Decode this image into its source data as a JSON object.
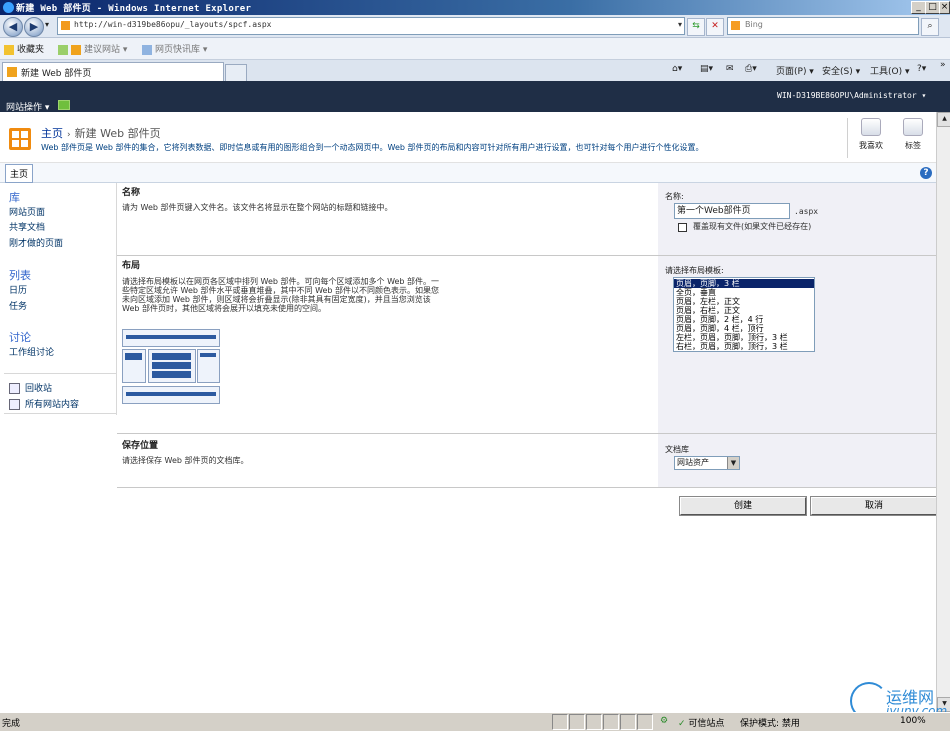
{
  "window": {
    "title": "新建 Web 部件页 - Windows Internet Explorer"
  },
  "address": {
    "url": "http://win-d319be86opu/_layouts/spcf.aspx",
    "search_placeholder": "Bing"
  },
  "favorites": {
    "label": "收藏夹",
    "items": [
      "建议网站 ▾",
      "网页快讯库 ▾"
    ]
  },
  "tab": {
    "title": "新建 Web 部件页"
  },
  "toolbar": {
    "page": "页面(P) ▾",
    "safety": "安全(S) ▾",
    "tools": "工具(O) ▾",
    "help": "?▾",
    "more": "»"
  },
  "sp": {
    "site_actions": "网站操作 ▾",
    "user": "WIN-D319BE86OPU\\Administrator ▾"
  },
  "titlearea": {
    "crumb_home": "主页",
    "crumb_sep": "›",
    "crumb_current": "新建 Web 部件页",
    "description": "Web 部件页是 Web 部件的集合，它将列表数据、即时信息或有用的图形组合到一个动态网页中。Web 部件页的布局和内容可针对所有用户进行设置，也可针对每个用户进行个性化设置。",
    "like": "我喜欢",
    "tags": "标签"
  },
  "topnav": {
    "home": "主页",
    "help": "?"
  },
  "leftnav": {
    "h_library": "库",
    "site_pages": "网站页面",
    "shared_docs": "共享文档",
    "recent_page": "刚才做的页面",
    "h_lists": "列表",
    "calendar": "日历",
    "tasks": "任务",
    "h_discussion": "讨论",
    "team_discussion": "工作组讨论",
    "recycle": "回收站",
    "all_content": "所有网站内容"
  },
  "form": {
    "name_heading": "名称",
    "name_desc": "请为 Web 部件页键入文件名。该文件名将显示在整个网站的标题和链接中。",
    "name_label": "名称:",
    "name_value": "第一个Web部件页",
    "ext": ".aspx",
    "overwrite": "覆盖现有文件(如果文件已经存在)",
    "layout_heading": "布局",
    "layout_desc": [
      "请选择布局模板以在网页各区域中排列 Web 部件。可向每个区域添加多个 Web 部件。一",
      "些特定区域允许 Web 部件水平或垂直堆叠，其中不同 Web 部件以不同颜色表示。如果您",
      "未向区域添加 Web 部件，则区域将会折叠显示(除非其具有固定宽度)，并且当您浏览该",
      "Web 部件页时，其他区域将会展开以填充未使用的空间。"
    ],
    "layout_label": "请选择布局模板:",
    "layout_options": [
      "页眉，页脚，3 栏",
      "全页，垂直",
      "页眉，左栏，正文",
      "页眉，右栏，正文",
      "页眉，页脚，2 栏，4 行",
      "页眉，页脚，4 栏，顶行",
      "左栏，页眉，页脚，顶行，3 栏",
      "右栏，页眉，页脚，顶行，3 栏"
    ],
    "save_heading": "保存位置",
    "save_desc": "请选择保存 Web 部件页的文档库。",
    "library_label": "文档库",
    "library_value": "网站资产",
    "create": "创建",
    "cancel": "取消"
  },
  "status": {
    "done": "完成",
    "trusted": "可信站点",
    "protected": "保护模式: 禁用",
    "zoom": "100%"
  },
  "watermark": {
    "text1": "运维网",
    "text2": "iyunv.com"
  }
}
